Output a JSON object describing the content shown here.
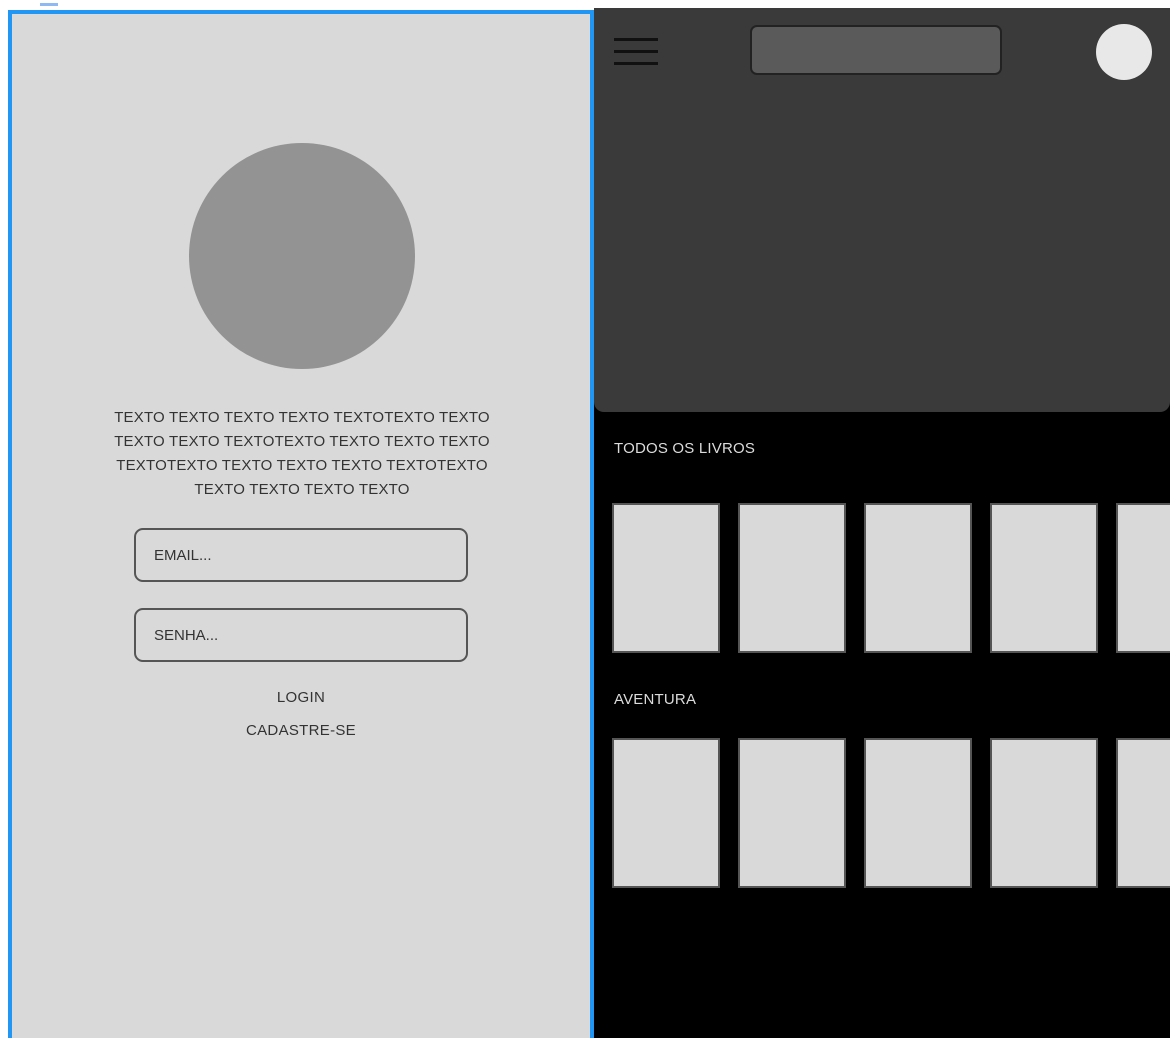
{
  "login": {
    "intro_text": "TEXTO TEXTO TEXTO TEXTO TEXTOTEXTO TEXTO\nTEXTO TEXTO TEXTOTEXTO TEXTO TEXTO TEXTO\nTEXTOTEXTO TEXTO TEXTO TEXTO TEXTOTEXTO\nTEXTO TEXTO TEXTO TEXTO",
    "email_placeholder": "EMAIL...",
    "password_placeholder": "SENHA...",
    "login_label": "LOGIN",
    "signup_label": "CADASTRE-SE"
  },
  "home": {
    "sections": [
      {
        "title": "TODOS OS LIVROS"
      },
      {
        "title": "AVENTURA"
      }
    ]
  },
  "icons": {
    "menu": "hamburger-menu-icon",
    "avatar": "user-avatar"
  },
  "colors": {
    "selection_border": "#2196f3",
    "login_bg": "#d9d9d9",
    "logo_placeholder": "#939393",
    "hero_bg": "#3a3a3a",
    "home_bg": "#000000",
    "book_placeholder": "#d9d9d9"
  }
}
